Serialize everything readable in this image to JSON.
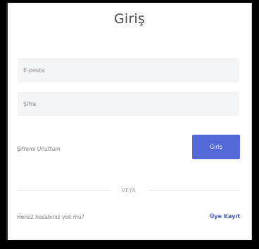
{
  "form": {
    "title": "Giriş",
    "email_placeholder": "E-posta",
    "password_placeholder": "Şifre",
    "forgot_label": "Şifremi Unuttum",
    "submit_label": "Giriş",
    "divider_label": "VEYA",
    "no_account_label": "Henüz hesabınız yok mu?",
    "register_label": "Üye Kayıt"
  },
  "colors": {
    "accent": "#5667d8",
    "link": "#4454c9",
    "field_bg": "#f4f5f7",
    "frame": "#000000"
  }
}
